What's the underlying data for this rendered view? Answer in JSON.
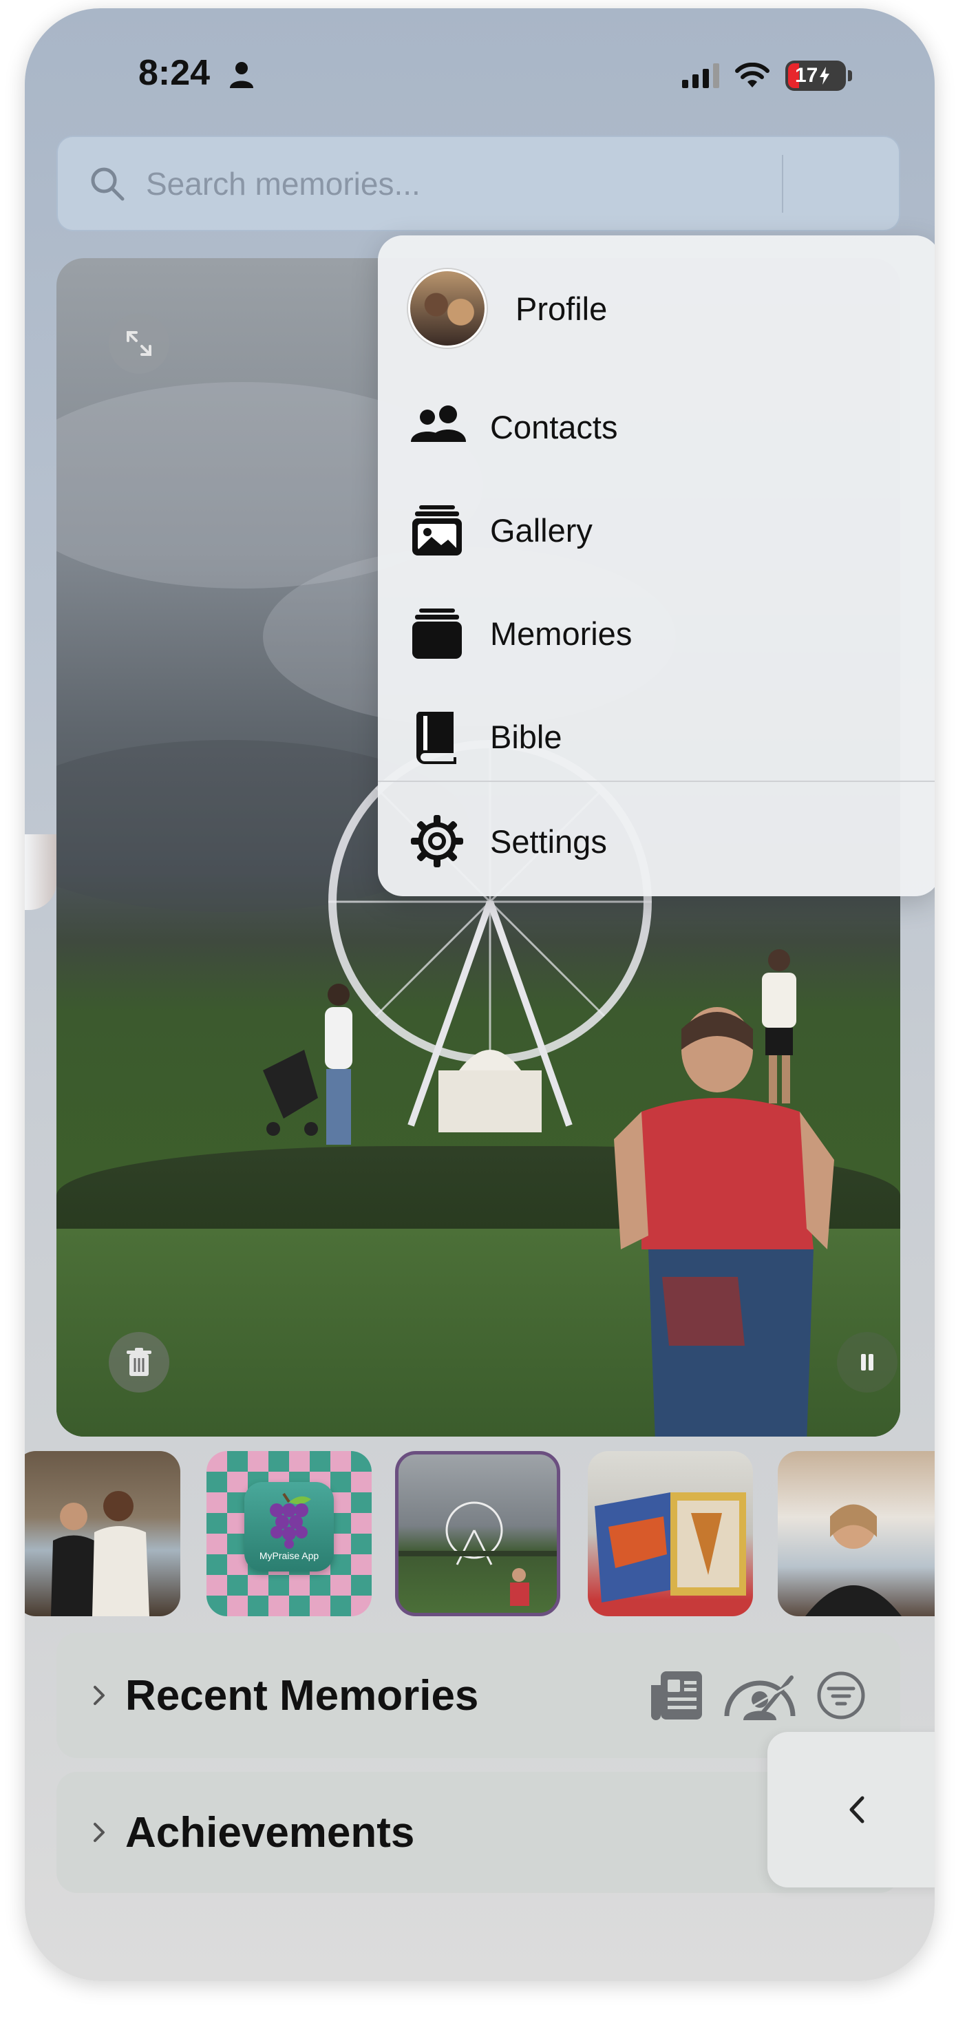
{
  "status_bar": {
    "time": "8:24",
    "battery": "17"
  },
  "search": {
    "placeholder": "Search memories..."
  },
  "menu": {
    "items": [
      {
        "label": "Profile",
        "icon": "profile-avatar"
      },
      {
        "label": "Contacts",
        "icon": "people-icon"
      },
      {
        "label": "Gallery",
        "icon": "photo-stack-icon"
      },
      {
        "label": "Memories",
        "icon": "stack-icon"
      },
      {
        "label": "Bible",
        "icon": "book-icon"
      },
      {
        "label": "Settings",
        "icon": "gear-icon"
      }
    ]
  },
  "thumbnails": [
    {
      "label": "",
      "selected": false
    },
    {
      "label": "MyPraise App",
      "selected": false
    },
    {
      "label": "",
      "selected": true
    },
    {
      "label": "",
      "selected": false
    },
    {
      "label": "",
      "selected": false
    }
  ],
  "panels": {
    "recent_memories": "Recent Memories",
    "achievements": "Achievements"
  },
  "colors": {
    "accent_selected_border": "#6b4f80",
    "battery_low": "#e8262c"
  }
}
